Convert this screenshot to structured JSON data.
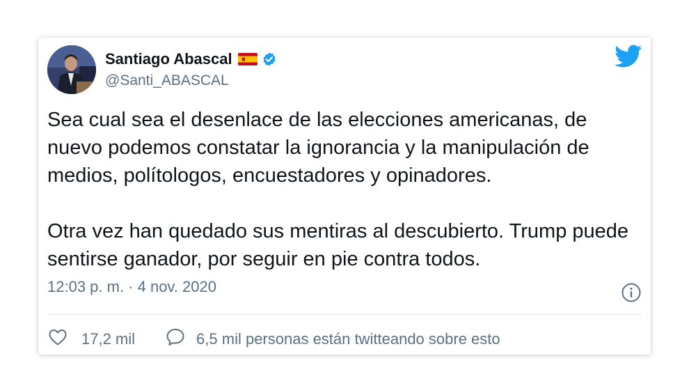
{
  "author": {
    "name": "Santiago Abascal",
    "handle": "@Santi_ABASCAL",
    "flag_icon": "spain-flag-icon",
    "verified_icon": "verified-badge-icon"
  },
  "tweet": {
    "paragraphs": [
      "Sea cual sea el desenlace de las elecciones americanas, de nuevo podemos constatar la ignorancia y la manipulación de medios, polítologos, encuestadores y opinadores.",
      "Otra vez han quedado sus mentiras al descubierto. Trump puede sentirse ganador, por seguir en pie contra todos."
    ],
    "timestamp": "12:03 p. m. · 4 nov. 2020"
  },
  "actions": {
    "like_count": "17,2 mil",
    "reply_text": "6,5 mil personas están twitteando sobre esto"
  },
  "colors": {
    "accent": "#1da1f2",
    "text": "#0f1419",
    "secondary": "#5b7083"
  }
}
